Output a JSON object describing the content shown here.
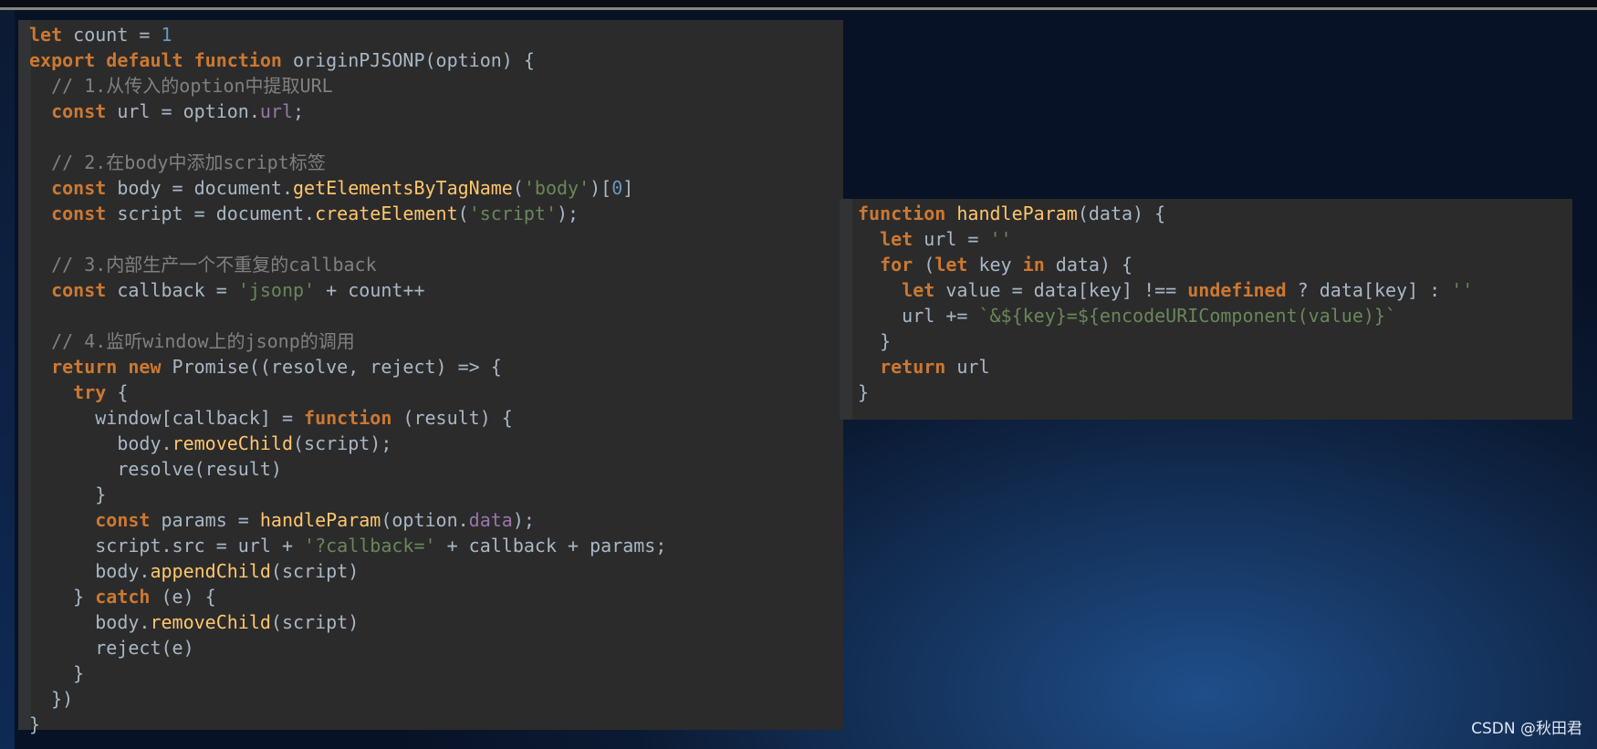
{
  "editor_left": {
    "lines": [
      [
        "let count = 1"
      ],
      [
        "export default function originPJSONP(option) {"
      ],
      [
        "  // 1.从传入的option中提取URL"
      ],
      [
        "  const url = option.url;"
      ],
      [
        ""
      ],
      [
        "  // 2.在body中添加script标签"
      ],
      [
        "  const body = document.getElementsByTagName('body')[0]"
      ],
      [
        "  const script = document.createElement('script');"
      ],
      [
        ""
      ],
      [
        "  // 3.内部生产一个不重复的callback"
      ],
      [
        "  const callback = 'jsonp' + count++"
      ],
      [
        ""
      ],
      [
        "  // 4.监听window上的jsonp的调用"
      ],
      [
        "  return new Promise((resolve, reject) => {"
      ],
      [
        "    try {"
      ],
      [
        "      window[callback] = function (result) {"
      ],
      [
        "        body.removeChild(script);"
      ],
      [
        "        resolve(result)"
      ],
      [
        "      }"
      ],
      [
        "      const params = handleParam(option.data);"
      ],
      [
        "      script.src = url + '?callback=' + callback + params;"
      ],
      [
        "      body.appendChild(script)"
      ],
      [
        "    } catch (e) {"
      ],
      [
        "      body.removeChild(script)"
      ],
      [
        "      reject(e)"
      ],
      [
        "    }"
      ],
      [
        "  })"
      ],
      [
        "}"
      ]
    ]
  },
  "editor_right": {
    "lines": [
      [
        "function handleParam(data) {"
      ],
      [
        "  let url = ''"
      ],
      [
        "  for (let key in data) {"
      ],
      [
        "    let value = data[key] !== undefined ? data[key] : ''"
      ],
      [
        "    url += `&${key}=${encodeURIComponent(value)}`"
      ],
      [
        "  }"
      ],
      [
        "  return url"
      ],
      [
        "}"
      ]
    ]
  },
  "watermark": "CSDN @秋田君",
  "colors": {
    "keyword": "#cc7832",
    "comment": "#808080",
    "string": "#6a8759",
    "number": "#6897bb",
    "function": "#ffc66d",
    "property": "#9876aa",
    "text": "#a9b7c6",
    "panel_bg": "#2b2b2b"
  }
}
